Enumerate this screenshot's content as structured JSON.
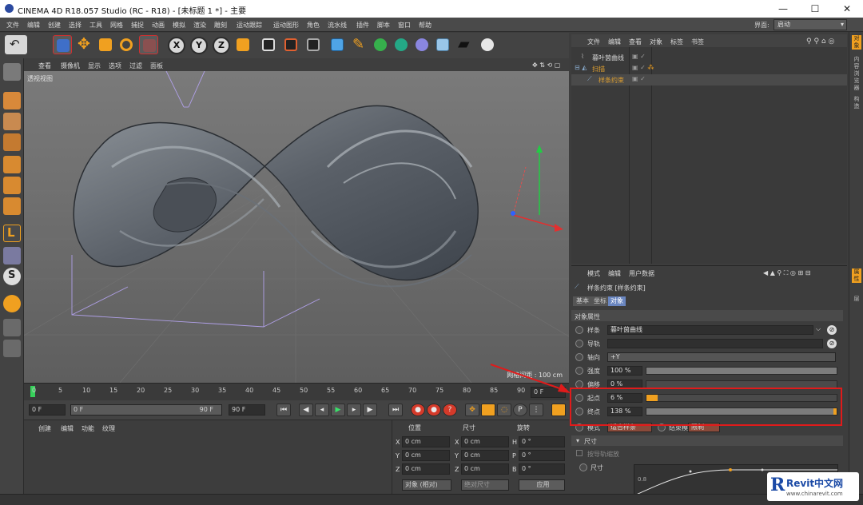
{
  "window": {
    "title": "CINEMA 4D R18.057 Studio (RC - R18) - [未标题 1 *] - 主要",
    "min_glyph": "—",
    "max_glyph": "☐",
    "close_glyph": "✕"
  },
  "menu": {
    "items": [
      "文件",
      "编辑",
      "创建",
      "选择",
      "工具",
      "网格",
      "捕捉",
      "动画",
      "模拟",
      "渲染",
      "雕刻",
      "运动跟踪",
      "运动图形",
      "角色",
      "流水线",
      "插件",
      "脚本",
      "窗口",
      "帮助"
    ],
    "layout_label": "界面:",
    "layout_value": "启动"
  },
  "viewport": {
    "menu": [
      "查看",
      "摄像机",
      "显示",
      "选项",
      "过滤",
      "面板"
    ],
    "label": "透视视图",
    "grid_label": "网格间距 : 100 cm"
  },
  "timeline": {
    "ticks": [
      "0",
      "5",
      "10",
      "15",
      "20",
      "25",
      "30",
      "35",
      "40",
      "45",
      "50",
      "55",
      "60",
      "65",
      "70",
      "75",
      "80",
      "85",
      "90"
    ],
    "current_frame": "0 F",
    "start_field": "0 F",
    "range_start": "0 F",
    "range_end": "90 F",
    "end_field": "90 F"
  },
  "material_panel": {
    "menu": [
      "创建",
      "编辑",
      "功能",
      "纹理"
    ]
  },
  "coord_panel": {
    "headers": [
      "位置",
      "尺寸",
      "旋转"
    ],
    "rows": [
      {
        "axis": "X",
        "pos": "0 cm",
        "size_axis": "X",
        "size": "0 cm",
        "rot_axis": "H",
        "rot": "0 °"
      },
      {
        "axis": "Y",
        "pos": "0 cm",
        "size_axis": "Y",
        "size": "0 cm",
        "rot_axis": "P",
        "rot": "0 °"
      },
      {
        "axis": "Z",
        "pos": "0 cm",
        "size_axis": "Z",
        "size": "0 cm",
        "rot_axis": "B",
        "rot": "0 °"
      }
    ],
    "mode_select": "对象 (相对)",
    "size_select": "绝对尺寸",
    "apply": "应用"
  },
  "object_manager": {
    "menu": [
      "文件",
      "编辑",
      "查看",
      "对象",
      "标签",
      "书签"
    ],
    "objects": [
      {
        "name": "暮叶茵曲线",
        "color": "#d6d6d6"
      },
      {
        "name": "扫描",
        "color": "#e0a030"
      },
      {
        "name": "样条约束",
        "color": "#e0a030"
      }
    ]
  },
  "attribute_manager": {
    "menu": [
      "模式",
      "编辑",
      "用户数据"
    ],
    "object_title": "样条约束 [样条约束]",
    "tabs": [
      "基本",
      "坐标",
      "对象"
    ],
    "section": "对象属性",
    "rows": [
      {
        "label": "样条",
        "value": "暮叶茵曲线"
      },
      {
        "label": "导轨",
        "value": ""
      },
      {
        "label": "轴向",
        "value": "+Y"
      },
      {
        "label": "强度",
        "value": "100 %",
        "fill": 1.0
      },
      {
        "label": "偏移",
        "value": "0 %",
        "fill": 0.0
      },
      {
        "label": "起点",
        "value": "6 %",
        "fill": 0.06
      },
      {
        "label": "终点",
        "value": "138 %",
        "fill": 1.0
      }
    ],
    "mode_label": "模式",
    "mode_value": "适合样条",
    "end_mode_label": "结束模式",
    "end_mode_value": "限制",
    "size_section": "尺寸",
    "size_check_label": "按导轨缩放",
    "size_label": "尺寸",
    "graph_label": "0.8"
  },
  "right_tabs": [
    "对象",
    "内容浏览器",
    "构造",
    "属性",
    "层"
  ],
  "watermark": {
    "brand": "Revit中文网",
    "url": "www.chinarevit.com"
  },
  "colors": {
    "accent": "#f0a020",
    "highlight": "#e01b1b"
  }
}
